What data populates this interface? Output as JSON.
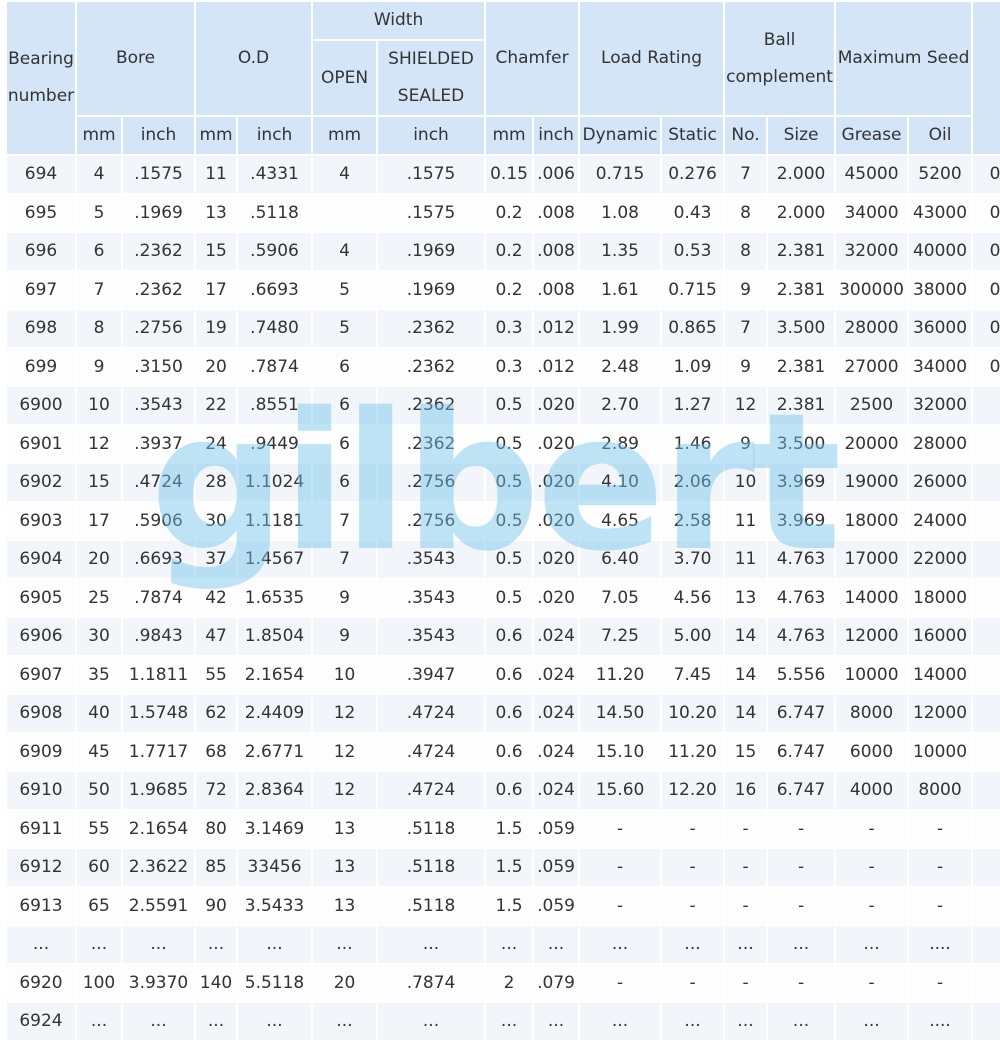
{
  "watermark": "gilbert",
  "header": {
    "bearing_number": [
      "Bearing",
      "number"
    ],
    "bore": "Bore",
    "od": "O.D",
    "width": "Width",
    "open": "OPEN",
    "shielded_sealed": [
      "SHIELDED",
      "SEALED"
    ],
    "chamfer": "Chamfer",
    "load_rating": "Load Rating",
    "ball_complement": [
      "Ball",
      "complement"
    ],
    "max_speed": "Maximum Seed",
    "sub": [
      "mm",
      "inch",
      "mm",
      "inch",
      "mm",
      "inch",
      "mm",
      "inch",
      "Dynamic",
      "Static",
      "No.",
      "Size",
      "Grease",
      "Oil"
    ]
  },
  "rows": [
    [
      "694",
      "4",
      ".1575",
      "11",
      ".4331",
      "4",
      ".1575",
      "0.15",
      ".006",
      "0.715",
      "0.276",
      "7",
      "2.000",
      "45000",
      "5200",
      "0"
    ],
    [
      "695",
      "5",
      ".1969",
      "13",
      ".5118",
      "",
      ".1575",
      "0.2",
      ".008",
      "1.08",
      "0.43",
      "8",
      "2.000",
      "34000",
      "43000",
      "0"
    ],
    [
      "696",
      "6",
      ".2362",
      "15",
      ".5906",
      "4",
      ".1969",
      "0.2",
      ".008",
      "1.35",
      "0.53",
      "8",
      "2.381",
      "32000",
      "40000",
      "0"
    ],
    [
      "697",
      "7",
      ".2362",
      "17",
      ".6693",
      "5",
      ".1969",
      "0.2",
      ".008",
      "1.61",
      "0.715",
      "9",
      "2.381",
      "300000",
      "38000",
      "0"
    ],
    [
      "698",
      "8",
      ".2756",
      "19",
      ".7480",
      "5",
      ".2362",
      "0.3",
      ".012",
      "1.99",
      "0.865",
      "7",
      "3.500",
      "28000",
      "36000",
      "0"
    ],
    [
      "699",
      "9",
      ".3150",
      "20",
      ".7874",
      "6",
      ".2362",
      "0.3",
      ".012",
      "2.48",
      "1.09",
      "9",
      "2.381",
      "27000",
      "34000",
      "0"
    ],
    [
      "6900",
      "10",
      ".3543",
      "22",
      ".8551",
      "6",
      ".2362",
      "0.5",
      ".020",
      "2.70",
      "1.27",
      "12",
      "2.381",
      "2500",
      "32000",
      ""
    ],
    [
      "6901",
      "12",
      ".3937",
      "24",
      ".9449",
      "6",
      ".2362",
      "0.5",
      ".020",
      "2.89",
      "1.46",
      "9",
      "3.500",
      "20000",
      "28000",
      ""
    ],
    [
      "6902",
      "15",
      ".4724",
      "28",
      "1.1024",
      "6",
      ".2756",
      "0.5",
      ".020",
      "4.10",
      "2.06",
      "10",
      "3.969",
      "19000",
      "26000",
      ""
    ],
    [
      "6903",
      "17",
      ".5906",
      "30",
      "1.1181",
      "7",
      ".2756",
      "0.5",
      ".020",
      "4.65",
      "2.58",
      "11",
      "3.969",
      "18000",
      "24000",
      ""
    ],
    [
      "6904",
      "20",
      ".6693",
      "37",
      "1.4567",
      "7",
      ".3543",
      "0.5",
      ".020",
      "6.40",
      "3.70",
      "11",
      "4.763",
      "17000",
      "22000",
      ""
    ],
    [
      "6905",
      "25",
      ".7874",
      "42",
      "1.6535",
      "9",
      ".3543",
      "0.5",
      ".020",
      "7.05",
      "4.56",
      "13",
      "4.763",
      "14000",
      "18000",
      ""
    ],
    [
      "6906",
      "30",
      ".9843",
      "47",
      "1.8504",
      "9",
      ".3543",
      "0.6",
      ".024",
      "7.25",
      "5.00",
      "14",
      "4.763",
      "12000",
      "16000",
      ""
    ],
    [
      "6907",
      "35",
      "1.1811",
      "55",
      "2.1654",
      "10",
      ".3947",
      "0.6",
      ".024",
      "11.20",
      "7.45",
      "14",
      "5.556",
      "10000",
      "14000",
      ""
    ],
    [
      "6908",
      "40",
      "1.5748",
      "62",
      "2.4409",
      "12",
      ".4724",
      "0.6",
      ".024",
      "14.50",
      "10.20",
      "14",
      "6.747",
      "8000",
      "12000",
      ""
    ],
    [
      "6909",
      "45",
      "1.7717",
      "68",
      "2.6771",
      "12",
      ".4724",
      "0.6",
      ".024",
      "15.10",
      "11.20",
      "15",
      "6.747",
      "6000",
      "10000",
      ""
    ],
    [
      "6910",
      "50",
      "1.9685",
      "72",
      "2.8364",
      "12",
      ".4724",
      "0.6",
      ".024",
      "15.60",
      "12.20",
      "16",
      "6.747",
      "4000",
      "8000",
      ""
    ],
    [
      "6911",
      "55",
      "2.1654",
      "80",
      "3.1469",
      "13",
      ".5118",
      "1.5",
      ".059",
      "-",
      "-",
      "-",
      "-",
      "-",
      "-",
      ""
    ],
    [
      "6912",
      "60",
      "2.3622",
      "85",
      "33456",
      "13",
      ".5118",
      "1.5",
      ".059",
      "-",
      "-",
      "-",
      "-",
      "-",
      "-",
      ""
    ],
    [
      "6913",
      "65",
      "2.5591",
      "90",
      "3.5433",
      "13",
      ".5118",
      "1.5",
      ".059",
      "-",
      "-",
      "-",
      "-",
      "-",
      "-",
      ""
    ],
    [
      "...",
      "...",
      "...",
      "...",
      "...",
      "...",
      "...",
      "...",
      "...",
      "...",
      "...",
      "...",
      "...",
      "...",
      "....",
      ""
    ],
    [
      "6920",
      "100",
      "3.9370",
      "140",
      "5.5118",
      "20",
      ".7874",
      "2",
      ".079",
      "-",
      "-",
      "-",
      "-",
      "-",
      "-",
      ""
    ],
    [
      "6924",
      "...",
      "...",
      "...",
      "...",
      "...",
      "...",
      "...",
      "...",
      "...",
      "...",
      "...",
      "...",
      "...",
      "....",
      ""
    ]
  ]
}
